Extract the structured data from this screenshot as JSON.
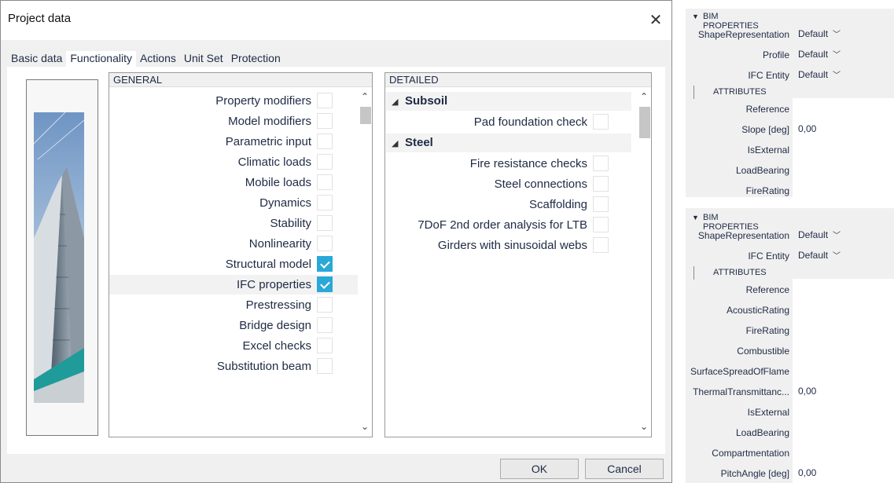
{
  "dialog": {
    "title": "Project data",
    "close_glyph": "✕",
    "tabs": [
      {
        "label": "Basic data",
        "active": false
      },
      {
        "label": "Functionality",
        "active": true
      },
      {
        "label": "Actions",
        "active": false
      },
      {
        "label": "Unit Set",
        "active": false
      },
      {
        "label": "Protection",
        "active": false
      }
    ],
    "general": {
      "header": "GENERAL",
      "items": [
        {
          "label": "Property modifiers",
          "checked": false
        },
        {
          "label": "Model modifiers",
          "checked": false
        },
        {
          "label": "Parametric input",
          "checked": false
        },
        {
          "label": "Climatic loads",
          "checked": false
        },
        {
          "label": "Mobile loads",
          "checked": false
        },
        {
          "label": "Dynamics",
          "checked": false
        },
        {
          "label": "Stability",
          "checked": false
        },
        {
          "label": "Nonlinearity",
          "checked": false
        },
        {
          "label": "Structural model",
          "checked": true
        },
        {
          "label": "IFC properties",
          "checked": true,
          "selected": true
        },
        {
          "label": "Prestressing",
          "checked": false
        },
        {
          "label": "Bridge design",
          "checked": false
        },
        {
          "label": "Excel checks",
          "checked": false
        },
        {
          "label": "Substitution beam",
          "checked": false
        }
      ]
    },
    "detailed": {
      "header": "DETAILED",
      "groups": [
        {
          "name": "Subsoil",
          "items": [
            {
              "label": "Pad foundation check",
              "checked": false
            }
          ]
        },
        {
          "name": "Steel",
          "items": [
            {
              "label": "Fire resistance checks",
              "checked": false
            },
            {
              "label": "Steel connections",
              "checked": false
            },
            {
              "label": "Scaffolding",
              "checked": false
            },
            {
              "label": "7DoF 2nd order analysis for LTB",
              "checked": false
            },
            {
              "label": "Girders with sinusoidal webs",
              "checked": false
            }
          ]
        }
      ]
    },
    "ok_label": "OK",
    "cancel_label": "Cancel"
  },
  "bim1": {
    "header": "BIM PROPERTIES",
    "rows_top": [
      {
        "label": "ShapeRepresentation",
        "value": "Default"
      },
      {
        "label": "Profile",
        "value": "Default"
      },
      {
        "label": "IFC Entity",
        "value": "Default"
      }
    ],
    "attributes_label": "ATTRIBUTES",
    "reference_label": "Reference",
    "slope_label": "Slope [deg]",
    "slope_value": "0,00",
    "isexternal_label": "IsExternal",
    "isexternal_on": false,
    "loadbearing_label": "LoadBearing",
    "loadbearing_on": true,
    "firerating_label": "FireRating"
  },
  "bim2": {
    "header": "BIM PROPERTIES",
    "shape_label": "ShapeRepresentation",
    "shape_value": "Default",
    "ifc_label": "IFC Entity",
    "ifc_value": "Default",
    "attributes_label": "ATTRIBUTES",
    "reference_label": "Reference",
    "acoustic_label": "AcousticRating",
    "firerating_label": "FireRating",
    "combustible_label": "Combustible",
    "combustible_on": false,
    "surface_label": "SurfaceSpreadOfFlame",
    "thermal_label": "ThermalTransmittanc...",
    "thermal_value": "0,00",
    "isexternal_label": "IsExternal",
    "isexternal_on": false,
    "loadbearing_label": "LoadBearing",
    "loadbearing_on": true,
    "compart_label": "Compartmentation",
    "compart_on": false,
    "pitch_label": "PitchAngle [deg]",
    "pitch_value": "0,00"
  }
}
